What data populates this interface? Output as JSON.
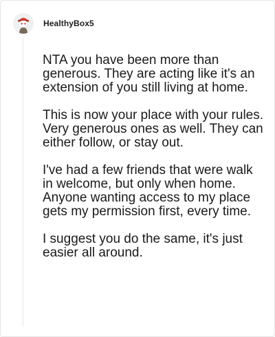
{
  "comment": {
    "author": "HealthyBox5",
    "avatar_icon": "snoo-avatar-icon",
    "paragraphs": [
      "NTA you have been more than generous. They are acting like it's an extension of you still living at home.",
      "This is now your place with your rules. Very generous ones as well. They can either follow, or stay out.",
      "I've had a few friends that were walk in welcome, but only when home. Anyone wanting access to my place gets my permission first, every time.",
      "I suggest you do the same, it's just easier all around."
    ]
  },
  "colors": {
    "text": "#1a1a1b",
    "border": "#e4e4e4",
    "thread_line": "#e6e6e6",
    "avatar_accent": "#d93a2b"
  }
}
